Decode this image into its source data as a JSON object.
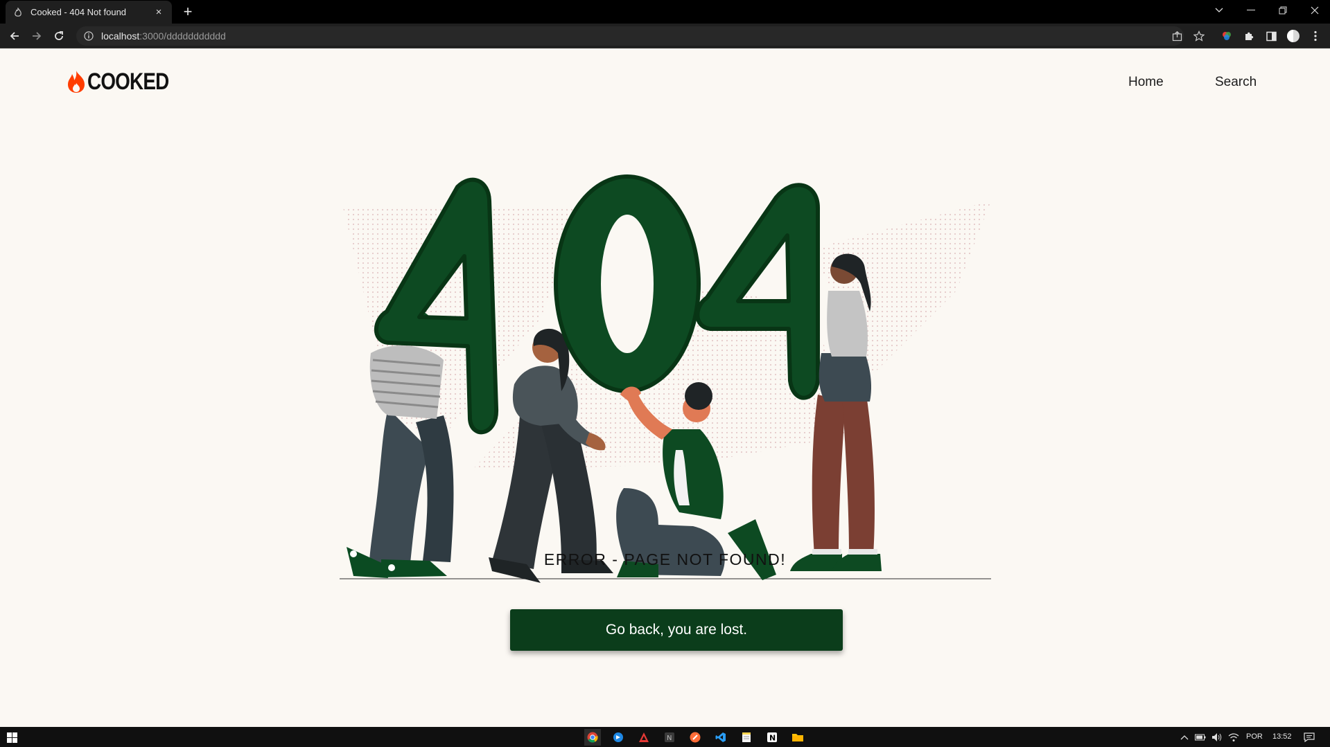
{
  "browser": {
    "tab_title": "Cooked - 404 Not found",
    "tab_close": "×",
    "new_tab": "+",
    "url_host": "localhost",
    "url_rest": ":3000/ddddddddddd",
    "window_controls": [
      "minimize-icon",
      "restore-icon",
      "close-icon"
    ]
  },
  "site": {
    "logo_text": "COOKED",
    "brand_color": "#ff3d00",
    "nav": {
      "home": "Home",
      "search": "Search"
    }
  },
  "error": {
    "illustration_text": "404",
    "message": "ERROR - PAGE NOT FOUND!",
    "button_label": "Go back, you are lost.",
    "accent_color": "#0b3d1b"
  },
  "taskbar": {
    "language": "POR",
    "time": "13:52",
    "apps": [
      "chrome-icon",
      "app-blue-icon",
      "app-red-icon",
      "notion-gray-icon",
      "postman-icon",
      "vscode-icon",
      "notes-icon",
      "notion-icon",
      "file-explorer-icon"
    ]
  }
}
